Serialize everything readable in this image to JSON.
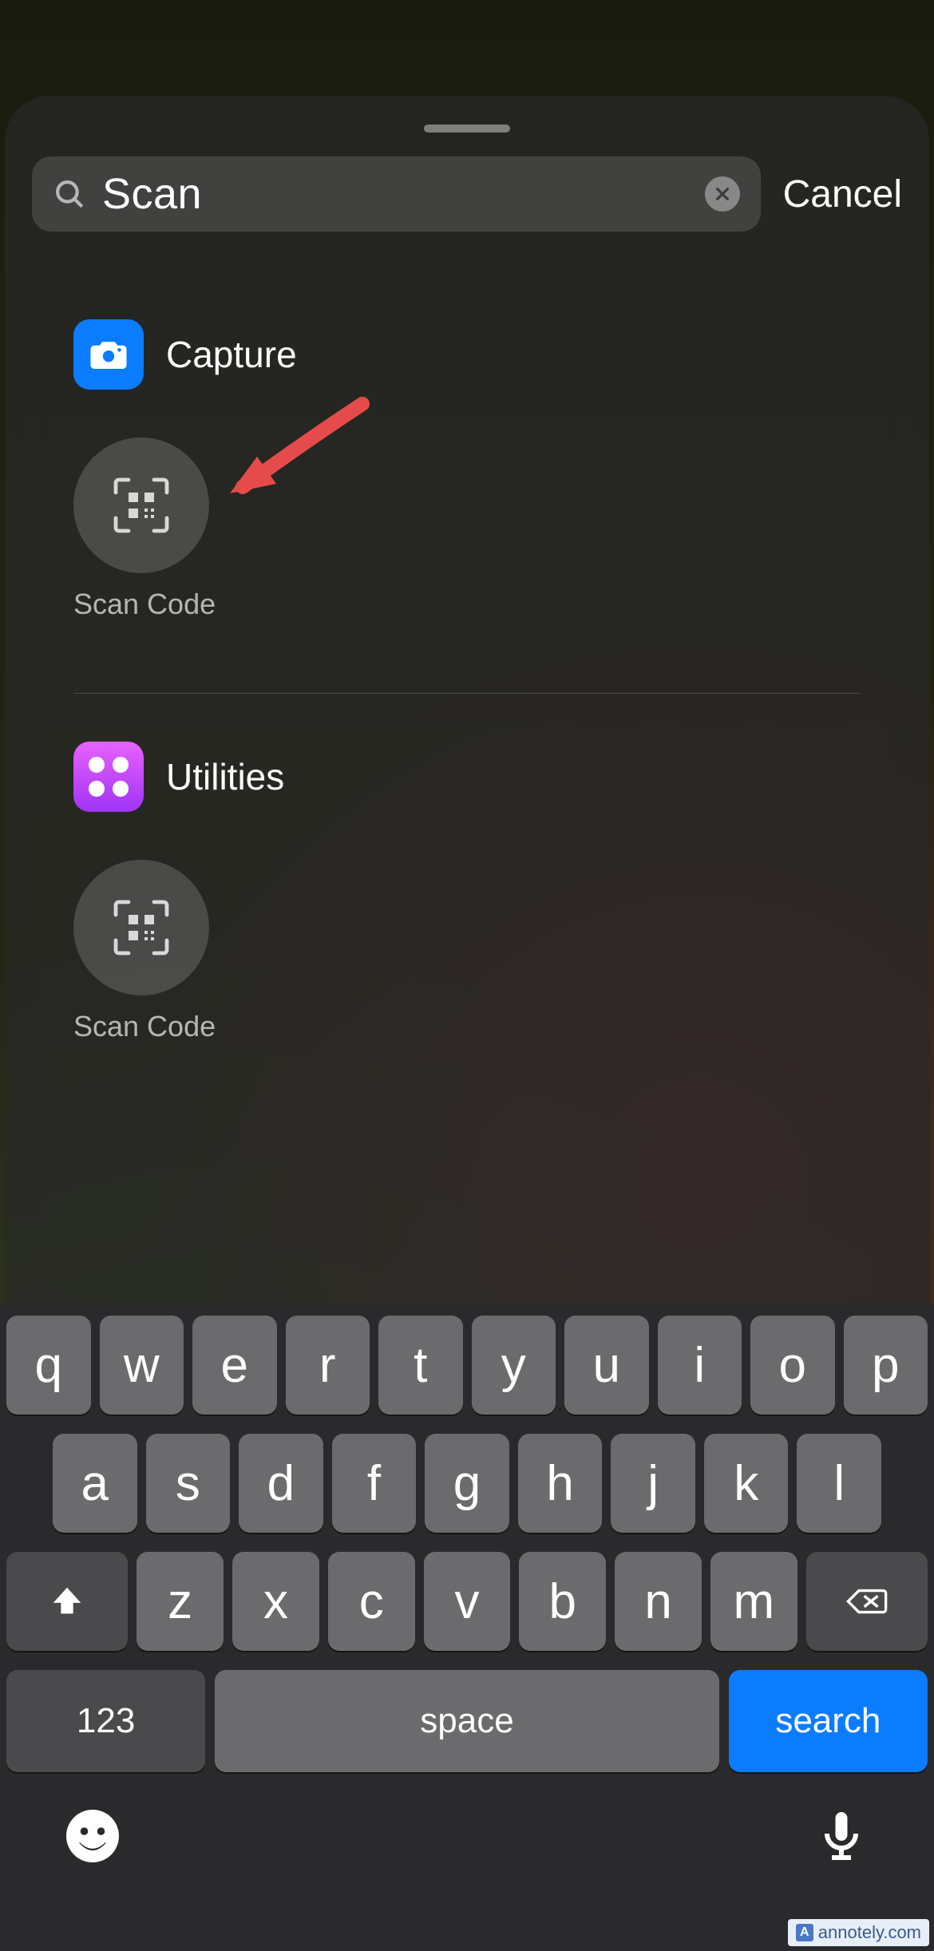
{
  "search": {
    "value": "Scan",
    "cancel_label": "Cancel"
  },
  "groups": [
    {
      "name": "Capture",
      "icon_color": "#0b7cff",
      "apps": [
        {
          "label": "Scan Code",
          "semantic": "scan-code-app"
        }
      ]
    },
    {
      "name": "Utilities",
      "icon_color": "#c044ff",
      "apps": [
        {
          "label": "Scan Code",
          "semantic": "scan-code-app"
        }
      ]
    }
  ],
  "annotation": {
    "arrow_target": "scan-code-app-capture"
  },
  "keyboard": {
    "row1": [
      "q",
      "w",
      "e",
      "r",
      "t",
      "y",
      "u",
      "i",
      "o",
      "p"
    ],
    "row2": [
      "a",
      "s",
      "d",
      "f",
      "g",
      "h",
      "j",
      "k",
      "l"
    ],
    "row3": [
      "z",
      "x",
      "c",
      "v",
      "b",
      "n",
      "m"
    ],
    "numbers_label": "123",
    "space_label": "space",
    "search_label": "search"
  },
  "watermark": "annotely.com"
}
